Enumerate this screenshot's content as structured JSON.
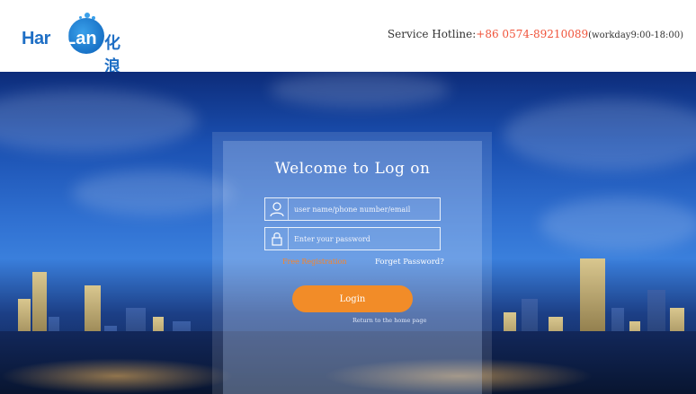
{
  "header": {
    "logo": {
      "name_en": "HarLan",
      "name_cn": "化浪"
    },
    "hotline": {
      "label": "Service Hotline:",
      "number": "+86 0574-89210089",
      "hours": "(workday9:00-18:00)"
    }
  },
  "login": {
    "title": "Welcome to Log on",
    "username_placeholder": "user name/phone number/email",
    "password_placeholder": "Enter your password",
    "free_registration": "Free Registration",
    "forget_password": "Forget Password?",
    "login_button": "Login",
    "return_home": "Return to the home page"
  },
  "icons": [
    "user-icon",
    "lock-icon"
  ],
  "colors": {
    "accent": "#f28c28",
    "brand": "#1f6fc5",
    "hotline": "#f0533a"
  }
}
